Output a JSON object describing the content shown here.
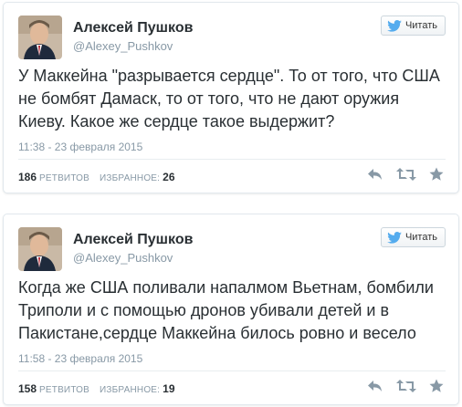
{
  "tweets": [
    {
      "name": "Алексей Пушков",
      "handle": "@Alexey_Pushkov",
      "follow_label": "Читать",
      "text": "У Маккейна \"разрывается сердце\". То от того, что США не бомбят Дамаск, то от того, что не дают оружия Киеву. Какое же сердце такое выдержит?",
      "time": "11:38 - 23 февраля 2015",
      "retweets_count": "186",
      "retweets_label": "РЕТВИТОВ",
      "favorites_label": "ИЗБРАННОЕ:",
      "favorites_count": "26"
    },
    {
      "name": "Алексей Пушков",
      "handle": "@Alexey_Pushkov",
      "follow_label": "Читать",
      "text": "Когда же США поливали напалмом Вьетнам, бомбили Триполи и с помощью дронов убивали детей и в Пакистане,сердце Маккейна билось ровно и весело",
      "time": "11:58 - 23 февраля 2015",
      "retweets_count": "158",
      "retweets_label": "РЕТВИТОВ",
      "favorites_label": "ИЗБРАННОЕ:",
      "favorites_count": "19"
    }
  ],
  "colors": {
    "text": "#292f33",
    "muted": "#8899a6",
    "twitter_blue": "#55acee",
    "border": "#e1e8ed"
  },
  "icons": [
    "twitter-bird-icon",
    "reply-icon",
    "retweet-icon",
    "favorite-star-icon"
  ]
}
